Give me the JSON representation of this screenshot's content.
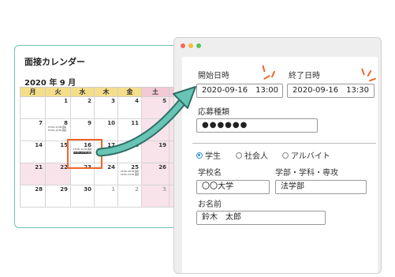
{
  "calendar": {
    "title": "面接カレンダー",
    "month": "2020 年 9 月",
    "weekdays": [
      "月",
      "火",
      "水",
      "木",
      "金",
      "土"
    ],
    "rows": [
      [
        "",
        "1",
        "2",
        "3",
        "4",
        "5"
      ],
      [
        "7",
        "8",
        "9",
        "10",
        "11",
        "12"
      ],
      [
        "14",
        "15",
        "16",
        "17",
        "18",
        "19"
      ],
      [
        "21",
        "22",
        "23",
        "24",
        "25",
        "26"
      ],
      [
        "28",
        "29",
        "30",
        "1",
        "2",
        "3"
      ]
    ],
    "events": {
      "d8a": "13:00~13:30 面接",
      "d8b": "14:00~14:30 面接",
      "d16a": "13:00~13:30 面接",
      "d16b": "14:00~14:30 面接",
      "d25a": "15:00~16:30 面接",
      "d25b": "14:00~14:30 面接"
    },
    "colors": {
      "header": "#f5de8a",
      "weekend": "#f8e3ea",
      "highlight": "#f0652a",
      "border": "#6cc3b4"
    }
  },
  "form": {
    "start_label": "開始日時",
    "start_value": "2020-09-16　13:00",
    "end_label": "終了日時",
    "end_value": "2020-09-16　13:30",
    "type_label": "応募種類",
    "type_value": "●●●●●●",
    "radio_options": [
      "学生",
      "社会人",
      "アルバイト"
    ],
    "selected_option": "学生",
    "school_label": "学校名",
    "school_value": "〇〇大学",
    "dept_label": "学部・学科・専攻",
    "dept_value": "法学部",
    "name_label": "お名前",
    "name_value": "鈴木　太郎"
  },
  "window": {
    "dot_colors": [
      "#f06a5b",
      "#f5bd3f",
      "#5ac05e"
    ],
    "arrow_color": "#68c5b5"
  }
}
